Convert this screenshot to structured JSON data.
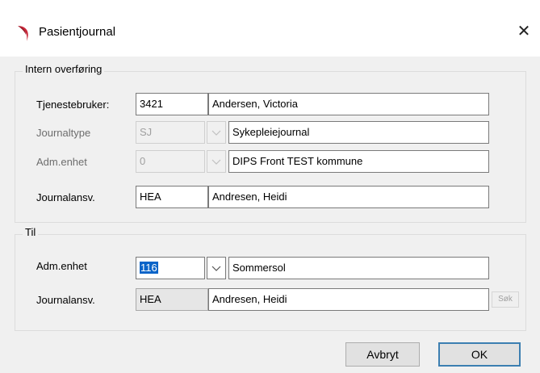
{
  "window": {
    "title": "Pasientjournal",
    "close_symbol": "✕"
  },
  "intern_group": {
    "title": "Intern overføring",
    "tjenestebruker": {
      "label": "Tjenestebruker:",
      "id": "3421",
      "name": "Andersen, Victoria"
    },
    "journaltype": {
      "label": "Journaltype",
      "code": "SJ",
      "name": "Sykepleiejournal"
    },
    "adm_enhet": {
      "label": "Adm.enhet",
      "code": "0",
      "name": "DIPS Front TEST kommune"
    },
    "journalansv": {
      "label": "Journalansv.",
      "code": "HEA",
      "name": "Andresen, Heidi"
    }
  },
  "til_group": {
    "title": "Til",
    "adm_enhet": {
      "label": "Adm.enhet",
      "code": "116",
      "name": "Sommersol"
    },
    "journalansv": {
      "label": "Journalansv.",
      "code": "HEA",
      "name": "Andresen, Heidi",
      "search_label": "Søk"
    }
  },
  "buttons": {
    "cancel": "Avbryt",
    "ok": "OK"
  },
  "colors": {
    "accent": "#0a64c8",
    "default_button_border": "#3c7fb1",
    "app_icon": "#c8283a"
  }
}
